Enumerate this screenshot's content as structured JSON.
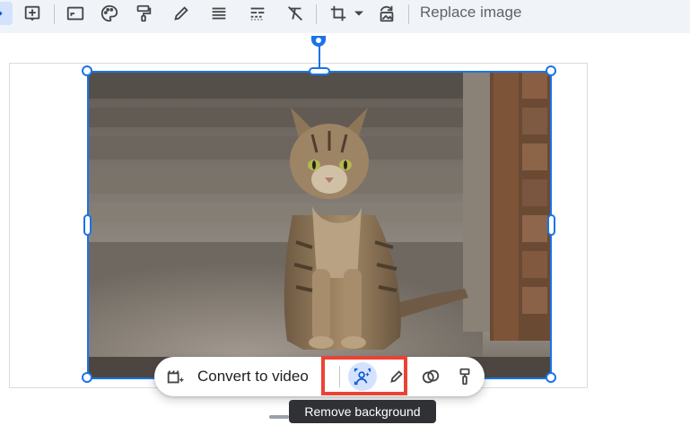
{
  "toolbar": {
    "replace_image_label": "Replace image",
    "icons": [
      "add-box-icon",
      "crop-frame-icon",
      "palette-icon",
      "paint-format-icon",
      "pencil-icon",
      "line-weight-icon",
      "line-dash-icon",
      "clear-formatting-icon",
      "crop-icon",
      "dropdown-arrow-icon",
      "reset-image-icon"
    ]
  },
  "image": {
    "subject": "tabby cat sitting on concrete step"
  },
  "floating_toolbar": {
    "convert_to_video_label": "Convert to video",
    "tooltip_remove_background": "Remove background"
  },
  "colors": {
    "accent": "#1a73e8",
    "highlight": "#ea4335",
    "toolbar_bg": "#f0f4f9",
    "tooltip_bg": "#303134"
  }
}
